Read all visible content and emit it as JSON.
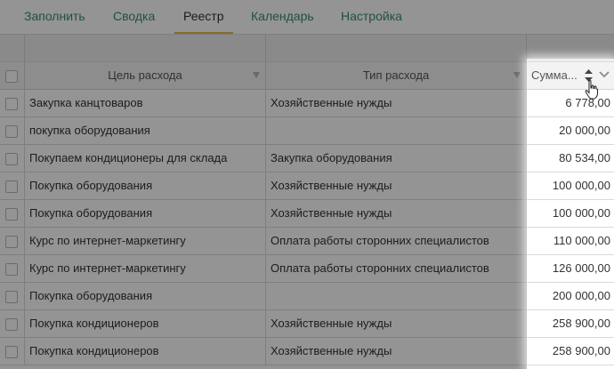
{
  "nav": {
    "tabs": [
      {
        "label": "Заполнить",
        "active": false
      },
      {
        "label": "Сводка",
        "active": false
      },
      {
        "label": "Реестр",
        "active": true
      },
      {
        "label": "Календарь",
        "active": false
      },
      {
        "label": "Настройка",
        "active": false
      }
    ]
  },
  "table": {
    "columns": {
      "purpose": "Цель расхода",
      "type": "Тип расхода",
      "sum": "Сумма..."
    },
    "rows": [
      {
        "purpose": "Закупка канцтоваров",
        "type": "Хозяйственные нужды",
        "sum": "6 778,00"
      },
      {
        "purpose": "покупка оборудования",
        "type": "",
        "sum": "20 000,00"
      },
      {
        "purpose": "Покупаем кондиционеры для склада",
        "type": "Закупка оборудования",
        "sum": "80 534,00"
      },
      {
        "purpose": "Покупка оборудования",
        "type": "Хозяйственные нужды",
        "sum": "100 000,00"
      },
      {
        "purpose": "Покупка оборудования",
        "type": "Хозяйственные нужды",
        "sum": "100 000,00"
      },
      {
        "purpose": "Курс по интернет-маркетингу",
        "type": "Оплата работы сторонних специалистов",
        "sum": "110 000,00"
      },
      {
        "purpose": "Курс по интернет-маркетингу",
        "type": "Оплата работы сторонних специалистов",
        "sum": "126 000,00"
      },
      {
        "purpose": "Покупка оборудования",
        "type": "",
        "sum": "200 000,00"
      },
      {
        "purpose": "Покупка кондиционеров",
        "type": "Хозяйственные нужды",
        "sum": "258 900,00"
      },
      {
        "purpose": "Покупка кондиционеров",
        "type": "Хозяйственные нужды",
        "sum": "258 900,00"
      }
    ]
  },
  "colors": {
    "tab_link": "#3a8a7a",
    "tab_active_underline": "#e0b84a"
  },
  "icons": {
    "sort": "sort-arrows-icon",
    "filter": "filter-icon",
    "dropdown": "chevron-down-icon",
    "cursor": "hand-pointer-icon"
  }
}
